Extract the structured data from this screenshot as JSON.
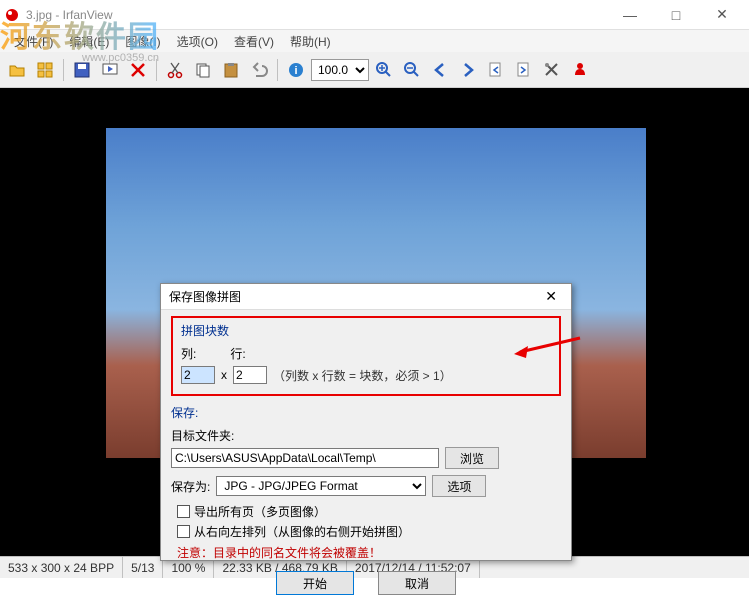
{
  "window": {
    "title": "3.jpg  -  IrfanView",
    "minimize": "—",
    "maximize": "□",
    "close": "✕"
  },
  "menu": {
    "file": "文件(F)",
    "edit": "编辑(E)",
    "image": "图像(I)",
    "options": "选项(O)",
    "view": "查看(V)",
    "help": "帮助(H)"
  },
  "toolbar": {
    "zoom_value": "100.0"
  },
  "dialog": {
    "title": "保存图像拼图",
    "tile_section": "拼图块数",
    "col_label": "列:",
    "row_label": "行:",
    "col_value": "2",
    "row_value": "2",
    "x_sep": "x",
    "hint": "（列数 x 行数 = 块数，必须 > 1）",
    "save_section": "保存:",
    "target_label": "目标文件夹:",
    "target_path": "C:\\Users\\ASUS\\AppData\\Local\\Temp\\",
    "browse": "浏览",
    "saveas_label": "保存为:",
    "format": "JPG - JPG/JPEG Format",
    "options": "选项",
    "chk_allpages": "导出所有页（多页图像）",
    "chk_rtl": "从右向左排列（从图像的右侧开始拼图）",
    "warn": "注意：目录中的同名文件将会被覆盖！",
    "start": "开始",
    "cancel": "取消",
    "close": "✕"
  },
  "statusbar": {
    "dim": "533 x 300 x 24 BPP",
    "page": "5/13",
    "zoom": "100 %",
    "size": "22.33 KB / 468.79 KB",
    "datetime": "2017/12/14 / 11:52:07"
  },
  "watermark": {
    "main": "河东软件园",
    "sub": "www.pc0359.cn"
  }
}
